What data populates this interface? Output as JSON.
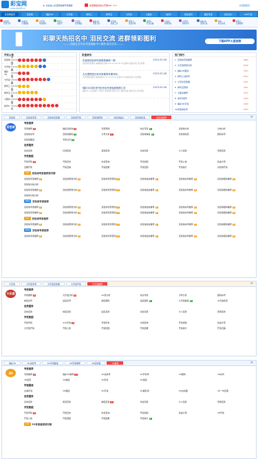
{
  "header": {
    "logo_text": "彩宝网",
    "logo_url": "www.00038.cn",
    "search_link": "点击进入彩宝网权威开奖数据",
    "promo_link": "彩宝网会员中心开通VIP",
    "promo_badge": "HOT",
    "right_link": "彩宝网首页"
  },
  "nav": [
    "彩宝网首页",
    "双色球",
    "福彩3D",
    "大乐透",
    "排列三",
    "排列五",
    "七乐彩",
    "七星彩",
    "快乐8",
    "综合资讯",
    "图表专区",
    "论坛中心",
    "APP下载"
  ],
  "subnav": [
    {
      "a": "双色球",
      "b": "开奖号码"
    },
    {
      "a": "3D彩宝",
      "b": "字谜图谜"
    },
    {
      "a": "大乐透",
      "b": "专家推荐"
    },
    {
      "a": "排列三",
      "b": "试机号"
    },
    {
      "a": "七乐彩",
      "b": "走势图表"
    },
    {
      "a": "福彩3D",
      "b": "历史开奖"
    },
    {
      "a": "双色球",
      "b": "缩水工具"
    },
    {
      "a": "排列五",
      "b": "奖金计算"
    },
    {
      "a": "快乐8",
      "b": "开奖直播"
    },
    {
      "a": "七星彩",
      "b": "预测专家"
    },
    {
      "a": "大乐透",
      "b": "胆码杀号"
    },
    {
      "a": "福彩3D",
      "b": "太湖字谜"
    },
    {
      "a": "体彩",
      "b": "综合资讯"
    },
    {
      "a": "排列三",
      "b": "近期推荐"
    }
  ],
  "banner": {
    "headline": "彩聊天热招名中 泪民交流 进群领彩图利",
    "sub": "———四维立交平台·彩宝直播·专人服务·高手交流———",
    "button": "下载APP火速进群"
  },
  "draws": {
    "title": "开奖公告",
    "rows": [
      {
        "name": "双色球",
        "issue": "第2024100期",
        "balls": [
          "r",
          "r",
          "r",
          "r",
          "r",
          "r",
          "b"
        ]
      },
      {
        "name": "大乐透",
        "issue": "第24100期",
        "balls": [
          "y",
          "y",
          "y",
          "y",
          "y",
          "b",
          "b"
        ]
      },
      {
        "name": "福彩3D",
        "issue": "第2024100期",
        "balls": [
          "r",
          "r",
          "r"
        ]
      },
      {
        "name": "七乐彩",
        "issue": "第2024100期",
        "balls": [
          "r",
          "r",
          "r",
          "r",
          "r",
          "r",
          "r",
          "b"
        ]
      },
      {
        "name": "排列三",
        "issue": "第24100期",
        "balls": [
          "y",
          "y",
          "y"
        ]
      },
      {
        "name": "排列五",
        "issue": "第24100期",
        "balls": [
          "y",
          "y",
          "y",
          "y",
          "y"
        ]
      },
      {
        "name": "七星彩",
        "issue": "第24100期",
        "balls": [
          "r",
          "r",
          "r",
          "r",
          "r",
          "r",
          "y"
        ]
      },
      {
        "name": "快乐8",
        "issue": "第2024100期",
        "balls": [
          "r",
          "r",
          "r",
          "r",
          "r",
          "r",
          "r",
          "r",
          "r",
          "r"
        ]
      }
    ]
  },
  "news": {
    "title": "彩宝资讯",
    "items": [
      {
        "t": "彩宝网双色球专家推荐最新一期",
        "date": "2023-03-08",
        "d": "双色球专家推荐 本期看好红球01 05 12 18 26 33 蓝球06 最新分析 点击查看"
      },
      {
        "t": "大乐透预测分析专家推荐本期号码",
        "date": "2023-03-08",
        "d": "大乐透专家推荐 前区看好03 11 19 24 32 后区02 09 最新分析 点击查看"
      },
      {
        "t": "福彩3D试机号开机号及专家独家推荐汇总",
        "date": "2023-03-08",
        "d": "福彩3D 今日试机号 开机号 专家推荐 胆码 杀号 和值 跨度 最新分析 点击查看"
      }
    ]
  },
  "ranking": {
    "title": "热门排行",
    "items": [
      {
        "l": "双色球专家推荐",
        "v": "9888"
      },
      {
        "l": "大乐透预测分析",
        "v": "8766"
      },
      {
        "l": "福彩3D图谜",
        "v": "7654"
      },
      {
        "l": "排列三试机号",
        "v": "6543"
      },
      {
        "l": "七乐彩走势图",
        "v": "5432"
      },
      {
        "l": "排列五预测",
        "v": "4321"
      },
      {
        "l": "七星彩推荐",
        "v": "3210"
      },
      {
        "l": "快乐8选号",
        "v": "2109"
      },
      {
        "l": "福彩3D字谜",
        "v": "1998"
      },
      {
        "l": "双色球杀号",
        "v": "1876"
      }
    ]
  },
  "sec1": {
    "tabs": [
      "双色球",
      "双色球专家",
      "双色球走势图",
      "双色球开奖",
      "双色球预测",
      "双色球缩水",
      "双色球机选"
    ],
    "hot_tab": "双色球推荐",
    "badge": "双色球",
    "groups": [
      {
        "g": "专家推荐",
        "cells": [
          [
            "专家推荐",
            "hot"
          ],
          [
            "福彩双色球",
            "hot"
          ],
          [
            "专家预测",
            ""
          ],
          [
            "热点专家",
            "new"
          ],
          [
            "双色球分析",
            ""
          ],
          [
            "冷热分析",
            ""
          ],
          [
            "双色球杀号",
            ""
          ],
          [
            "双色球胆码",
            "new"
          ],
          [
            "冷号分析",
            "hot"
          ],
          [
            "双色球跨度",
            "new"
          ],
          [
            "双色球和值",
            ""
          ],
          [
            "胆码杀号",
            ""
          ],
          [
            "双色球图谜",
            ""
          ],
          [
            "专家点评",
            "new"
          ]
        ]
      },
      {
        "g": "走势图表",
        "cells": [
          [
            "基本走势",
            ""
          ],
          [
            "红球走势",
            ""
          ],
          [
            "蓝球走势",
            ""
          ],
          [
            "综合走势",
            ""
          ],
          [
            "大小走势",
            ""
          ],
          [
            "奇偶走势",
            ""
          ]
        ]
      },
      {
        "g": "开奖数据",
        "cells": [
          [
            "开奖号码",
            "hot"
          ],
          [
            "开奖历史",
            ""
          ],
          [
            "中奖查询",
            ""
          ],
          [
            "开奖视频",
            ""
          ],
          [
            "开奖公告",
            ""
          ],
          [
            "奖金计算",
            ""
          ],
          [
            "近期开奖",
            ""
          ],
          [
            "开奖直播",
            ""
          ],
          [
            "开奖结果",
            ""
          ],
          [
            "开奖回顾",
            ""
          ],
          [
            "开奖统计",
            ""
          ],
          [
            "双色球开奖",
            ""
          ]
        ]
      }
    ],
    "yellow": "双色球专家推荐排行榜",
    "ylines": [
      [
        [
          "双色球专家推荐",
          "sup"
        ],
        [
          "双色球预测分析",
          "sup"
        ],
        [
          "双色球专家预测",
          "sup"
        ],
        [
          "双色球最新推荐",
          "sup"
        ],
        [
          "双色球杀号推荐",
          "sup"
        ],
        [
          "双色球胆码推荐",
          "sup"
        ],
        [
          "双色球冷热分析",
          ""
        ]
      ],
      [
        [
          "双色球专家推荐",
          "sup"
        ],
        [
          "双色球预测分析",
          "sup"
        ],
        [
          "双色球专家预测",
          "sup"
        ],
        [
          "双色球最新推荐",
          "sup"
        ],
        [
          "双色球杀号推荐",
          "sup"
        ],
        [
          "双色球胆码推荐",
          "sup"
        ],
        [
          "双色球冷热分析",
          ""
        ]
      ]
    ],
    "blue": "双色球专家推荐",
    "blines": [
      [
        [
          "双色球专家推荐",
          "sup"
        ],
        [
          "双色球预测分析",
          "sup"
        ],
        [
          "双色球专家预测",
          "sup"
        ],
        [
          "双色球最新推荐",
          "sup"
        ],
        [
          "双色球杀号推荐",
          "sup"
        ],
        [
          "双色球胆码推荐",
          "sup"
        ]
      ],
      [
        [
          "双色球专家推荐",
          "sup"
        ],
        [
          "双色球预测分析",
          "sup"
        ],
        [
          "双色球专家预测",
          "sup"
        ],
        [
          "双色球最新推荐",
          "sup"
        ],
        [
          "双色球杀号推荐",
          "sup"
        ],
        [
          "双色球胆码推荐",
          "sup"
        ]
      ]
    ],
    "y2": "双色球专家推荐",
    "y2lines": [
      [
        [
          "双色球专家推荐",
          "sup"
        ],
        [
          "双色球预测分析",
          "sup"
        ],
        [
          "双色球专家预测",
          "sup"
        ],
        [
          "双色球最新推荐",
          "sup"
        ],
        [
          "双色球杀号推荐",
          "sup"
        ],
        [
          "双色球胆码推荐",
          "sup"
        ]
      ]
    ],
    "b2": "双色球专家推荐",
    "b2lines": [
      [
        [
          "双色球专家推荐",
          "sup"
        ],
        [
          "双色球预测分析",
          "sup"
        ],
        [
          "双色球专家预测",
          "sup"
        ],
        [
          "双色球最新推荐",
          "sup"
        ],
        [
          "双色球杀号推荐",
          "sup"
        ],
        [
          "双色球胆码推荐",
          "sup"
        ]
      ]
    ]
  },
  "sec2": {
    "tabs": [
      "大乐透",
      "大乐透专家",
      "大乐透走势图",
      "大乐透开奖"
    ],
    "hot_tab": "大乐透推荐",
    "badge": "大乐透",
    "groups": [
      {
        "g": "专家推荐",
        "cells": [
          [
            "专家推荐",
            "hot"
          ],
          [
            "大乐透分析",
            "hot"
          ],
          [
            "AC值分析",
            ""
          ],
          [
            "热点专家",
            ""
          ],
          [
            "冷号分析",
            ""
          ],
          [
            "胆码杀号",
            ""
          ],
          [
            "前区杀号",
            ""
          ],
          [
            "后区杀号",
            ""
          ],
          [
            "前区胆码",
            ""
          ],
          [
            "后区胆码",
            "new"
          ],
          [
            "大乐透跨度",
            "new"
          ],
          [
            "大乐透和值",
            ""
          ]
        ]
      },
      {
        "g": "走势图表",
        "cells": [
          [
            "基本走势",
            ""
          ],
          [
            "前区走势",
            ""
          ],
          [
            "后区走势",
            ""
          ],
          [
            "综合走势",
            ""
          ],
          [
            "大小走势",
            ""
          ],
          [
            "奇偶走势",
            ""
          ]
        ]
      },
      {
        "g": "开奖数据",
        "cells": [
          [
            "开奖号码",
            ""
          ],
          [
            "AI大乐透",
            "hot"
          ],
          [
            "开奖历史",
            ""
          ],
          [
            "中奖查询",
            ""
          ],
          [
            "开奖视频",
            ""
          ],
          [
            "奖金计算",
            ""
          ],
          [
            "大乐透开奖",
            ""
          ],
          [
            "开奖公告",
            ""
          ],
          [
            "开奖回顾",
            ""
          ],
          [
            "开奖结果",
            ""
          ],
          [
            "开奖统计",
            ""
          ],
          [
            "开奖直播",
            ""
          ]
        ]
      }
    ]
  },
  "sec3": {
    "tabs": [
      "福彩3D",
      "3D试机号",
      "3D字谜图谜",
      "3D专家推荐",
      "3D走势图"
    ],
    "hot_tab": "3D推荐",
    "badge": "3D",
    "groups": [
      {
        "g": "专家推荐",
        "cells": [
          [
            "专家推荐",
            "hot"
          ],
          [
            "福彩3D推荐",
            "hot"
          ],
          [
            "3D试机号",
            ""
          ],
          [
            "3D开机号",
            ""
          ],
          [
            "3D胆码",
            ""
          ],
          [
            "3D杀号",
            ""
          ],
          [
            "3D和值",
            ""
          ],
          [
            "3D跨度",
            ""
          ],
          [
            "3D定位",
            ""
          ],
          [
            "3D组选",
            ""
          ]
        ]
      },
      {
        "g": "字谜图谜",
        "cells": [
          [
            "太湖字谜",
            ""
          ],
          [
            "3D图谜",
            ""
          ],
          [
            "3D字谜",
            ""
          ],
          [
            "3D藏机诗",
            ""
          ],
          [
            "3D玄机图",
            ""
          ],
          [
            "3D一句定胆",
            ""
          ]
        ]
      },
      {
        "g": "走势图表",
        "cells": [
          [
            "基本走势",
            ""
          ],
          [
            "和值走势",
            ""
          ],
          [
            "跨度走势",
            "hot"
          ],
          [
            "综合走势",
            ""
          ],
          [
            "大小走势",
            ""
          ],
          [
            "奇偶走势",
            ""
          ]
        ]
      },
      {
        "g": "开奖数据",
        "cells": [
          [
            "开奖号码",
            "hot"
          ],
          [
            "开奖历史",
            ""
          ],
          [
            "中奖查询",
            ""
          ],
          [
            "开奖视频",
            ""
          ],
          [
            "奖金计算",
            ""
          ],
          [
            "3D开奖",
            ""
          ],
          [
            "开奖公告",
            ""
          ],
          [
            "开奖回顾",
            ""
          ],
          [
            "开奖结果",
            ""
          ],
          [
            "开奖统计",
            "new"
          ]
        ]
      }
    ],
    "yellow": "P3专家推荐排行榜"
  }
}
